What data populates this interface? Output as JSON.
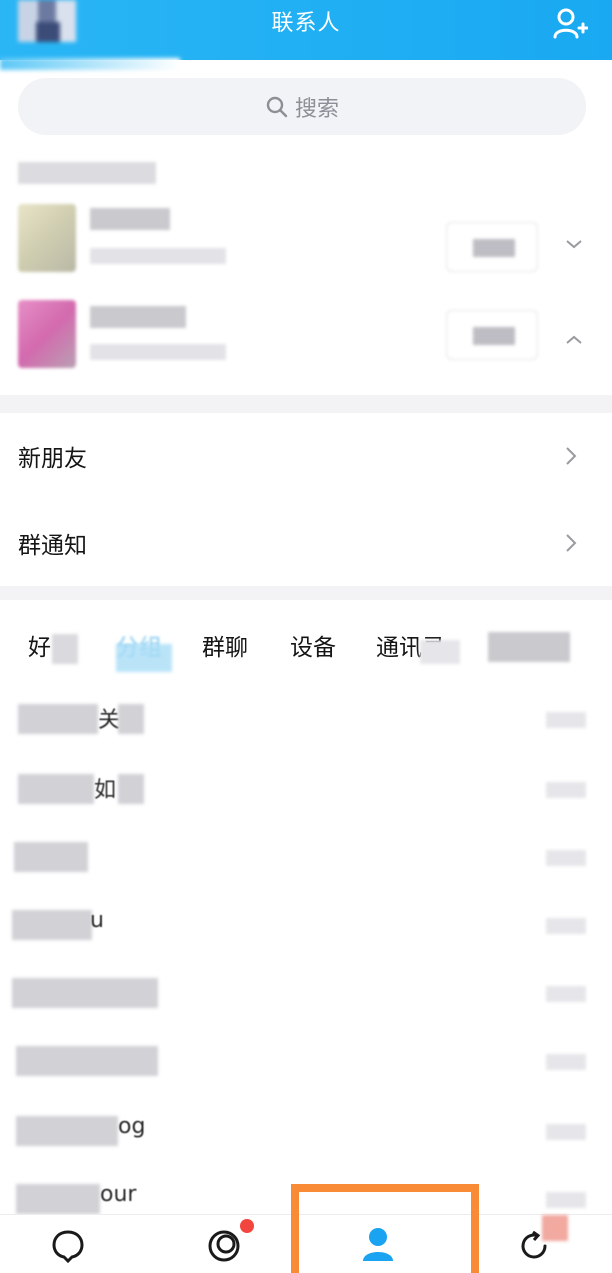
{
  "header": {
    "title": "联系人",
    "add_contact_icon": "add-person-icon",
    "accent_color": "#19a9f2"
  },
  "search": {
    "placeholder": "搜索",
    "icon": "search-icon"
  },
  "menu": {
    "new_friends": "新朋友",
    "group_notice": "群通知"
  },
  "tabs": [
    {
      "label": "好"
    },
    {
      "label": "分组"
    },
    {
      "label": "群聊"
    },
    {
      "label": "设备"
    },
    {
      "label": "通讯录"
    }
  ],
  "friends": [
    {
      "visible_text": "关"
    },
    {
      "visible_text": "如"
    },
    {
      "visible_text": ""
    },
    {
      "visible_text": "u"
    },
    {
      "visible_text": ""
    },
    {
      "visible_text": ""
    },
    {
      "visible_text": "og"
    },
    {
      "visible_text": "our"
    }
  ],
  "bottom_nav": [
    {
      "icon": "message-icon",
      "active": false
    },
    {
      "icon": "world-icon",
      "active": false,
      "has_badge": true
    },
    {
      "icon": "contacts-icon",
      "active": true
    },
    {
      "icon": "dynamic-icon",
      "active": false
    }
  ],
  "colors": {
    "highlight_box": "#f98b36",
    "badge": "#f2453d",
    "active_tab": "#1aa3f0"
  }
}
